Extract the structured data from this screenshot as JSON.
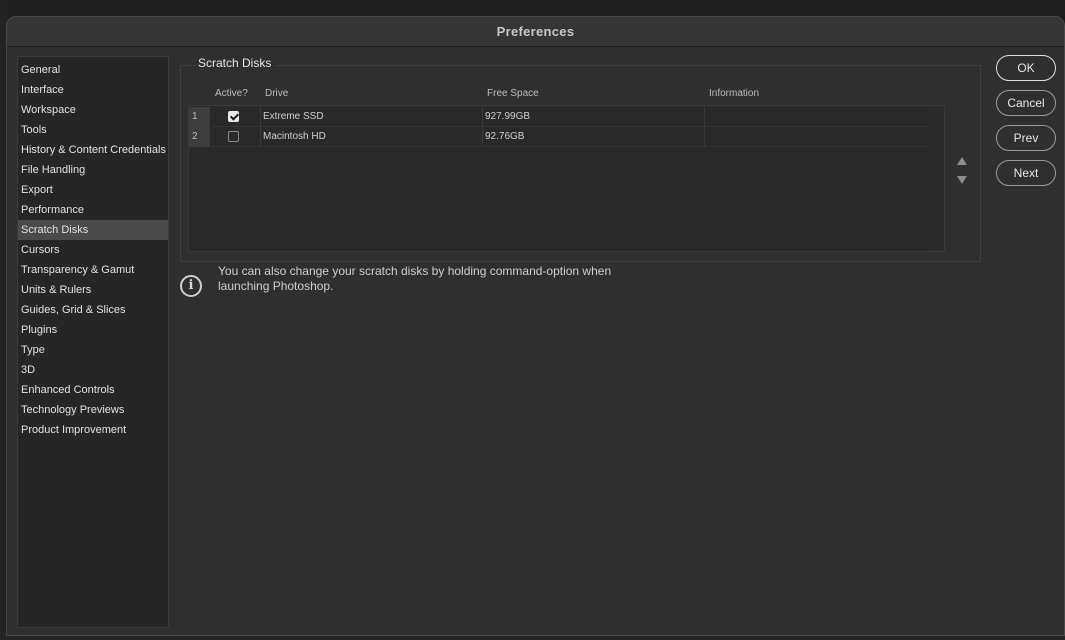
{
  "window": {
    "title": "Preferences"
  },
  "sidebar": {
    "items": [
      {
        "label": "General"
      },
      {
        "label": "Interface"
      },
      {
        "label": "Workspace"
      },
      {
        "label": "Tools"
      },
      {
        "label": "History & Content Credentials"
      },
      {
        "label": "File Handling"
      },
      {
        "label": "Export"
      },
      {
        "label": "Performance"
      },
      {
        "label": "Scratch Disks",
        "active": true
      },
      {
        "label": "Cursors"
      },
      {
        "label": "Transparency & Gamut"
      },
      {
        "label": "Units & Rulers"
      },
      {
        "label": "Guides, Grid & Slices"
      },
      {
        "label": "Plugins"
      },
      {
        "label": "Type"
      },
      {
        "label": "3D"
      },
      {
        "label": "Enhanced Controls"
      },
      {
        "label": "Technology Previews"
      },
      {
        "label": "Product Improvement"
      }
    ]
  },
  "scratch": {
    "title": "Scratch Disks",
    "columns": {
      "active": "Active?",
      "drive": "Drive",
      "free": "Free Space",
      "info": "Information"
    },
    "rows": [
      {
        "num": "1",
        "checked": true,
        "drive": "Extreme SSD",
        "free": "927.99GB",
        "info": ""
      },
      {
        "num": "2",
        "checked": false,
        "drive": "Macintosh HD",
        "free": "92.76GB",
        "info": ""
      }
    ],
    "note": "You can also change your scratch disks by holding command-option when launching Photoshop.",
    "info_icon": "i"
  },
  "buttons": {
    "ok": "OK",
    "cancel": "Cancel",
    "prev": "Prev",
    "next": "Next"
  },
  "icons": {
    "move_up": "triangle-up",
    "move_down": "triangle-down",
    "info": "info-circle"
  }
}
